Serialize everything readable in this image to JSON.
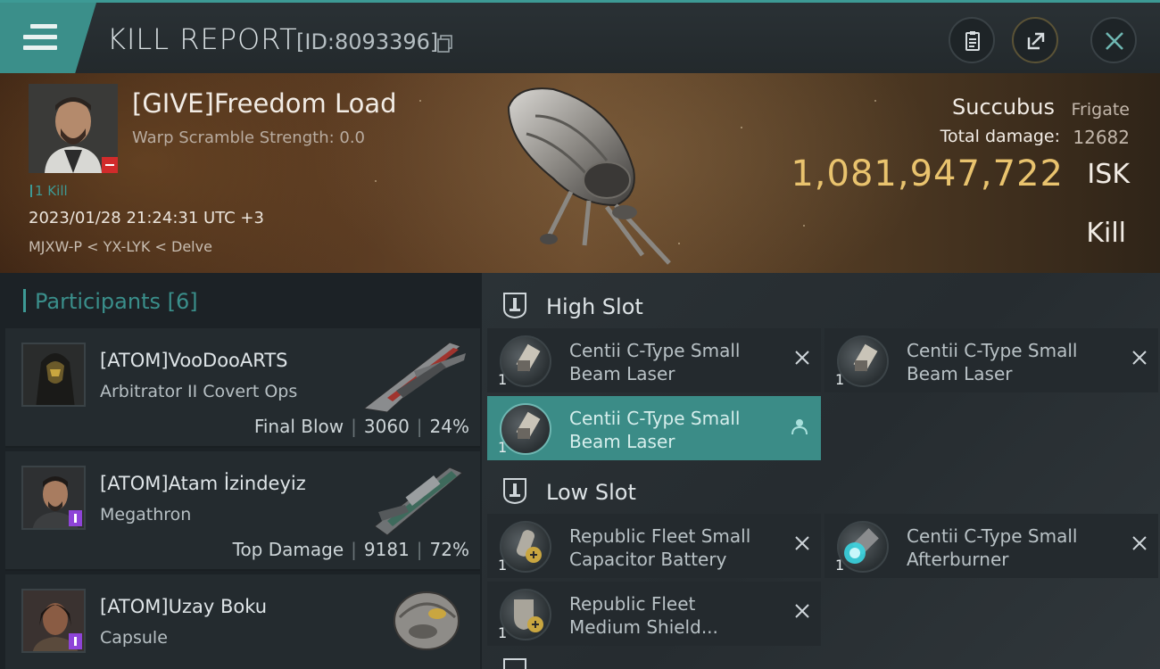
{
  "header": {
    "title": "KILL REPORT",
    "report_id": "[ID:8093396]",
    "icons": [
      "menu-icon",
      "copy-icon",
      "clipboard-icon",
      "share-icon",
      "close-icon"
    ]
  },
  "victim": {
    "name": "[GIVE]Freedom Load",
    "warp_scramble": "Warp Scramble Strength: 0.0",
    "kills": "1 Kill",
    "datetime": "2023/01/28 21:24:31 UTC +3",
    "location": "MJXW-P < YX-LYK < Delve"
  },
  "ship": {
    "name": "Succubus",
    "class": "Frigate",
    "total_damage_label": "Total damage:",
    "total_damage": "12682",
    "isk_value": "1,081,947,722",
    "isk_unit": "ISK",
    "result": "Kill"
  },
  "participants": {
    "title": "Participants",
    "count": "[6]",
    "rows": [
      {
        "name": "[ATOM]VooDooARTS",
        "ship": "Arbitrator II Covert Ops",
        "role": "Final Blow",
        "damage": "3060",
        "percent": "24%"
      },
      {
        "name": "[ATOM]Atam İzindeyiz",
        "ship": "Megathron",
        "role": "Top Damage",
        "damage": "9181",
        "percent": "72%"
      },
      {
        "name": "[ATOM]Uzay Boku",
        "ship": "Capsule",
        "role": "",
        "damage": "",
        "percent": ""
      }
    ]
  },
  "fitting": {
    "high_slot": {
      "label": "High Slot",
      "modules": [
        {
          "line1": "Centii C-Type Small",
          "line2": "Beam Laser",
          "qty": "1"
        },
        {
          "line1": "Centii C-Type Small",
          "line2": "Beam Laser",
          "qty": "1"
        },
        {
          "line1": "Centii C-Type Small",
          "line2": "Beam Laser",
          "qty": "1"
        }
      ]
    },
    "low_slot": {
      "label": "Low Slot",
      "modules": [
        {
          "line1": "Republic Fleet Small",
          "line2": "Capacitor Battery",
          "qty": "1"
        },
        {
          "line1": "Centii C-Type Small",
          "line2": "Afterburner",
          "qty": "1"
        },
        {
          "line1": "Republic Fleet",
          "line2": "Medium Shield...",
          "qty": "1"
        }
      ]
    }
  },
  "colors": {
    "accent": "#3d9a95",
    "isk_gold": "#e9c36e",
    "active_module": "#3b8c87"
  }
}
